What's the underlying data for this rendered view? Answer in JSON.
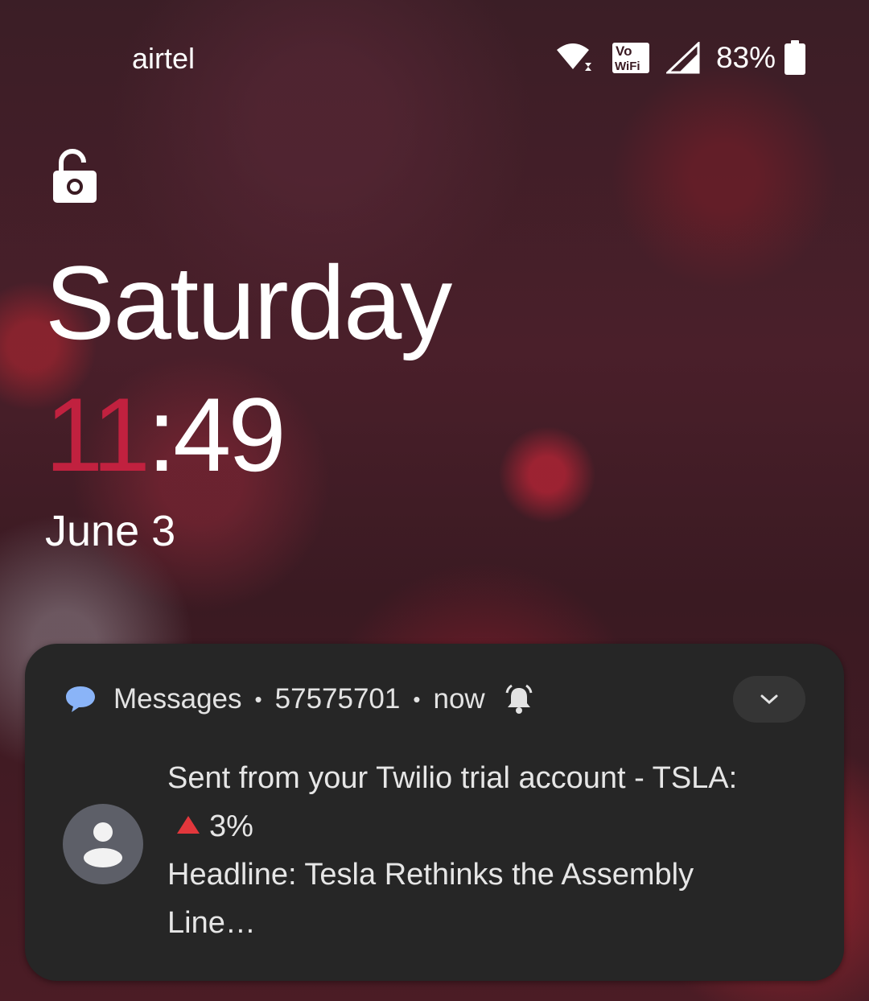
{
  "status_bar": {
    "carrier": "airtel",
    "battery_percent": "83%",
    "wifi_icon": "wifi-icon",
    "vowifi_label_top": "Vo",
    "vowifi_label_bottom": "WiFi",
    "signal_icon": "cell-signal-icon",
    "battery_icon": "battery-icon"
  },
  "lock": {
    "icon": "unlocked-padlock-icon"
  },
  "clock": {
    "day": "Saturday",
    "hour": "11",
    "separator": ":",
    "minutes": "49",
    "date": "June 3",
    "accent_color": "#c1213f"
  },
  "notification": {
    "app_name": "Messages",
    "sender": "57575701",
    "time": "now",
    "separator": "•",
    "app_icon": "message-bubble-icon",
    "alert_icon": "bell-icon",
    "expand_icon": "chevron-down-icon",
    "avatar_icon": "person-icon",
    "body_line1": "Sent from your Twilio trial account - TSLA:",
    "body_line2_value": "3%",
    "body_line2_indicator": "red-up-triangle",
    "body_line3": "Headline: Tesla Rethinks the Assembly",
    "body_line4": "Line…",
    "background_color": "#262626"
  }
}
